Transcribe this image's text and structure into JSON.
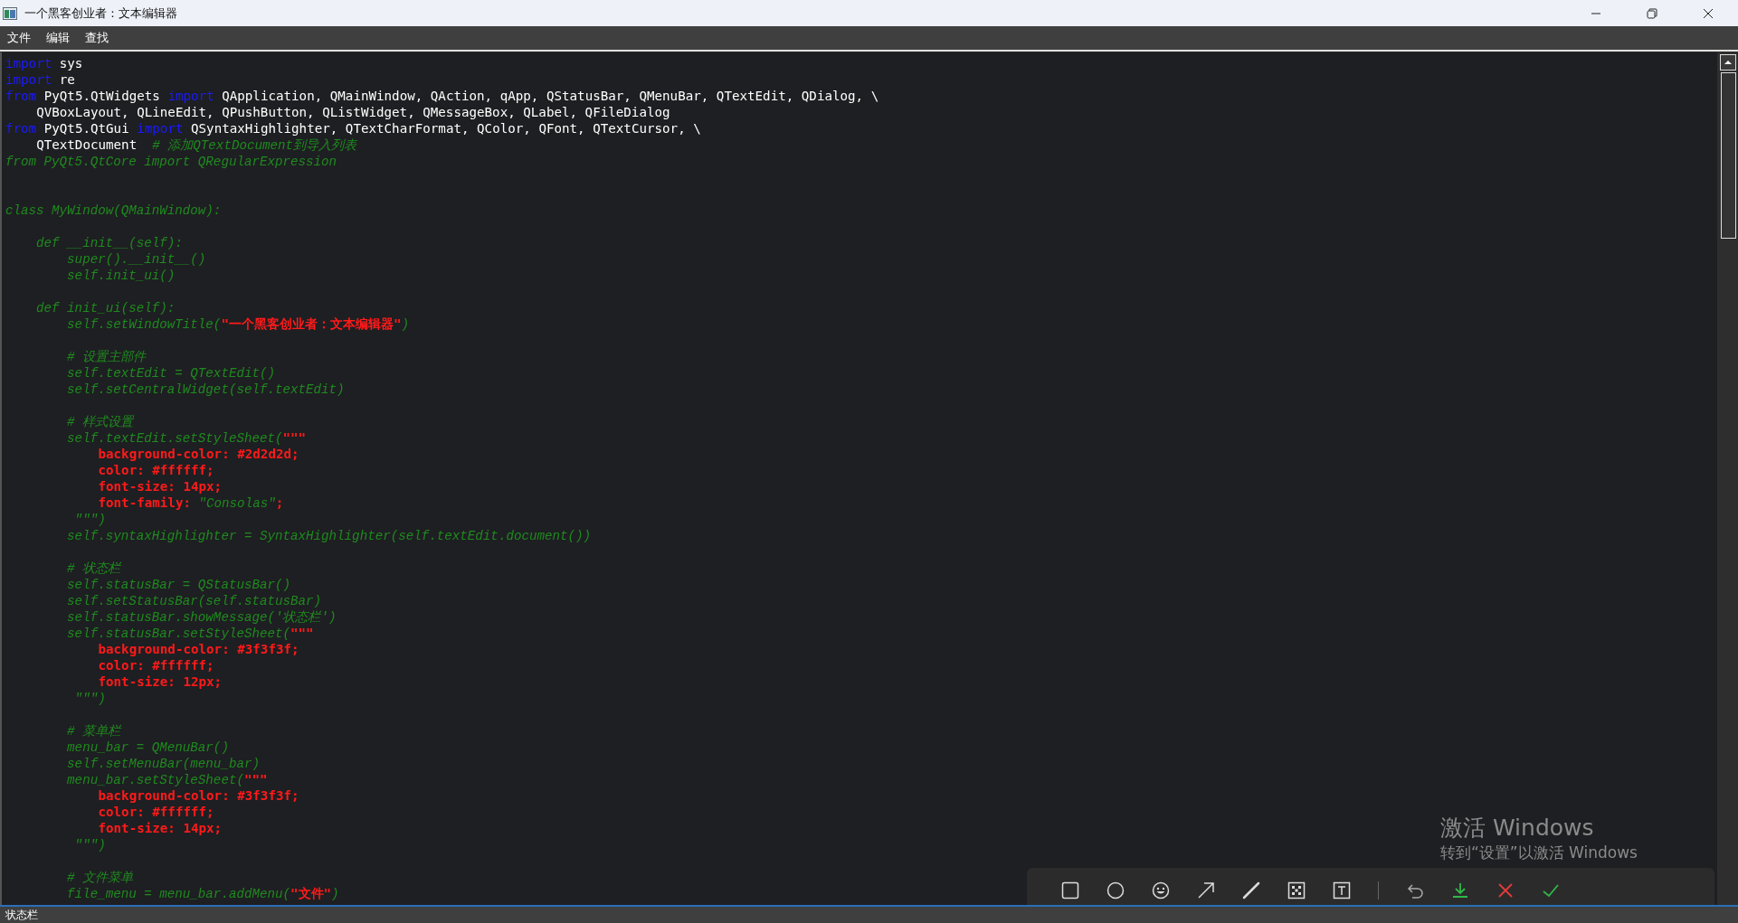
{
  "window": {
    "title": "一个黑客创业者：文本编辑器"
  },
  "menu_bar": [
    {
      "label": "文件"
    },
    {
      "label": "编辑"
    },
    {
      "label": "查找"
    }
  ],
  "editor": {
    "lines": [
      {
        "kind": "code",
        "segments": [
          {
            "kind": "keyword",
            "text": "import"
          },
          {
            "kind": "plain",
            "text": " sys"
          }
        ]
      },
      {
        "kind": "code",
        "segments": [
          {
            "kind": "keyword",
            "text": "import"
          },
          {
            "kind": "plain",
            "text": " re"
          }
        ]
      },
      {
        "kind": "code",
        "segments": [
          {
            "kind": "keyword",
            "text": "from"
          },
          {
            "kind": "plain",
            "text": " PyQt5.QtWidgets "
          },
          {
            "kind": "keyword",
            "text": "import"
          },
          {
            "kind": "plain",
            "text": " QApplication, QMainWindow, QAction, qApp, QStatusBar, QMenuBar, QTextEdit, QDialog, \\"
          }
        ]
      },
      {
        "kind": "code",
        "segments": [
          {
            "kind": "plain",
            "text": "    QVBoxLayout, QLineEdit, QPushButton, QListWidget, QMessageBox, QLabel, QFileDialog"
          }
        ]
      },
      {
        "kind": "code",
        "segments": [
          {
            "kind": "keyword",
            "text": "from"
          },
          {
            "kind": "plain",
            "text": " PyQt5.QtGui "
          },
          {
            "kind": "keyword",
            "text": "import"
          },
          {
            "kind": "plain",
            "text": " QSyntaxHighlighter, QTextCharFormat, QColor, QFont, QTextCursor, \\"
          }
        ]
      },
      {
        "kind": "code",
        "segments": [
          {
            "kind": "plain",
            "text": "    QTextDocument  "
          },
          {
            "kind": "comment",
            "text": "# 添加QTextDocument到导入列表"
          }
        ]
      },
      {
        "kind": "code",
        "segments": [
          {
            "kind": "comment",
            "text": "from PyQt5.QtCore import QRegularExpression"
          }
        ]
      },
      {
        "kind": "blank"
      },
      {
        "kind": "blank"
      },
      {
        "kind": "code",
        "segments": [
          {
            "kind": "comment",
            "text": "class MyWindow(QMainWindow):"
          }
        ]
      },
      {
        "kind": "blank"
      },
      {
        "kind": "code",
        "segments": [
          {
            "kind": "comment",
            "text": "    def __init__(self):"
          }
        ]
      },
      {
        "kind": "code",
        "segments": [
          {
            "kind": "comment",
            "text": "        super().__init__()"
          }
        ]
      },
      {
        "kind": "code",
        "segments": [
          {
            "kind": "comment",
            "text": "        self.init_ui()"
          }
        ]
      },
      {
        "kind": "blank"
      },
      {
        "kind": "code",
        "segments": [
          {
            "kind": "comment",
            "text": "    def init_ui(self):"
          }
        ]
      },
      {
        "kind": "code",
        "segments": [
          {
            "kind": "comment",
            "text": "        self.setWindowTitle("
          },
          {
            "kind": "string",
            "text": "\"一个黑客创业者：文本编辑器\""
          },
          {
            "kind": "comment",
            "text": ")"
          }
        ]
      },
      {
        "kind": "blank"
      },
      {
        "kind": "code",
        "segments": [
          {
            "kind": "comment",
            "text": "        # 设置主部件"
          }
        ]
      },
      {
        "kind": "code",
        "segments": [
          {
            "kind": "comment",
            "text": "        self.textEdit = QTextEdit()"
          }
        ]
      },
      {
        "kind": "code",
        "segments": [
          {
            "kind": "comment",
            "text": "        self.setCentralWidget(self.textEdit)"
          }
        ]
      },
      {
        "kind": "blank"
      },
      {
        "kind": "code",
        "segments": [
          {
            "kind": "comment",
            "text": "        # 样式设置"
          }
        ]
      },
      {
        "kind": "code",
        "segments": [
          {
            "kind": "comment",
            "text": "        self.textEdit.setStyleSheet("
          },
          {
            "kind": "string",
            "text": "\"\"\""
          }
        ]
      },
      {
        "kind": "code",
        "segments": [
          {
            "kind": "string",
            "text": "            background-color: #2d2d2d;"
          }
        ]
      },
      {
        "kind": "code",
        "segments": [
          {
            "kind": "string",
            "text": "            color: #ffffff;"
          }
        ]
      },
      {
        "kind": "code",
        "segments": [
          {
            "kind": "string",
            "text": "            font-size: 14px;"
          }
        ]
      },
      {
        "kind": "code",
        "segments": [
          {
            "kind": "string",
            "text": "            font-family: "
          },
          {
            "kind": "comment",
            "text": "\"Consolas\""
          },
          {
            "kind": "string",
            "text": ";"
          }
        ]
      },
      {
        "kind": "code",
        "segments": [
          {
            "kind": "comment",
            "text": "         \"\"\")"
          }
        ]
      },
      {
        "kind": "code",
        "segments": [
          {
            "kind": "comment",
            "text": "        self.syntaxHighlighter = SyntaxHighlighter(self.textEdit.document())"
          }
        ]
      },
      {
        "kind": "blank"
      },
      {
        "kind": "code",
        "segments": [
          {
            "kind": "comment",
            "text": "        # 状态栏"
          }
        ]
      },
      {
        "kind": "code",
        "segments": [
          {
            "kind": "comment",
            "text": "        self.statusBar = QStatusBar()"
          }
        ]
      },
      {
        "kind": "code",
        "segments": [
          {
            "kind": "comment",
            "text": "        self.setStatusBar(self.statusBar)"
          }
        ]
      },
      {
        "kind": "code",
        "segments": [
          {
            "kind": "comment",
            "text": "        self.statusBar.showMessage('状态栏')"
          }
        ]
      },
      {
        "kind": "code",
        "segments": [
          {
            "kind": "comment",
            "text": "        self.statusBar.setStyleSheet("
          },
          {
            "kind": "string",
            "text": "\"\"\""
          }
        ]
      },
      {
        "kind": "code",
        "segments": [
          {
            "kind": "string",
            "text": "            background-color: #3f3f3f;"
          }
        ]
      },
      {
        "kind": "code",
        "segments": [
          {
            "kind": "string",
            "text": "            color: #ffffff;"
          }
        ]
      },
      {
        "kind": "code",
        "segments": [
          {
            "kind": "string",
            "text": "            font-size: 12px;"
          }
        ]
      },
      {
        "kind": "code",
        "segments": [
          {
            "kind": "comment",
            "text": "         \"\"\")"
          }
        ]
      },
      {
        "kind": "blank"
      },
      {
        "kind": "code",
        "segments": [
          {
            "kind": "comment",
            "text": "        # 菜单栏"
          }
        ]
      },
      {
        "kind": "code",
        "segments": [
          {
            "kind": "comment",
            "text": "        menu_bar = QMenuBar()"
          }
        ]
      },
      {
        "kind": "code",
        "segments": [
          {
            "kind": "comment",
            "text": "        self.setMenuBar(menu_bar)"
          }
        ]
      },
      {
        "kind": "code",
        "segments": [
          {
            "kind": "comment",
            "text": "        menu_bar.setStyleSheet("
          },
          {
            "kind": "string",
            "text": "\"\"\""
          }
        ]
      },
      {
        "kind": "code",
        "segments": [
          {
            "kind": "string",
            "text": "            background-color: #3f3f3f;"
          }
        ]
      },
      {
        "kind": "code",
        "segments": [
          {
            "kind": "string",
            "text": "            color: #ffffff;"
          }
        ]
      },
      {
        "kind": "code",
        "segments": [
          {
            "kind": "string",
            "text": "            font-size: 14px;"
          }
        ]
      },
      {
        "kind": "code",
        "segments": [
          {
            "kind": "comment",
            "text": "         \"\"\")"
          }
        ]
      },
      {
        "kind": "blank"
      },
      {
        "kind": "code",
        "segments": [
          {
            "kind": "comment",
            "text": "        # 文件菜单"
          }
        ]
      },
      {
        "kind": "code",
        "segments": [
          {
            "kind": "comment",
            "text": "        file_menu = menu_bar.addMenu("
          },
          {
            "kind": "string",
            "text": "\"文件\""
          },
          {
            "kind": "comment",
            "text": ")"
          }
        ]
      }
    ]
  },
  "status_bar": {
    "message": "状态栏"
  },
  "activation_notice": {
    "title": "激活 Windows",
    "subtitle": "转到“设置”以激活 Windows"
  }
}
